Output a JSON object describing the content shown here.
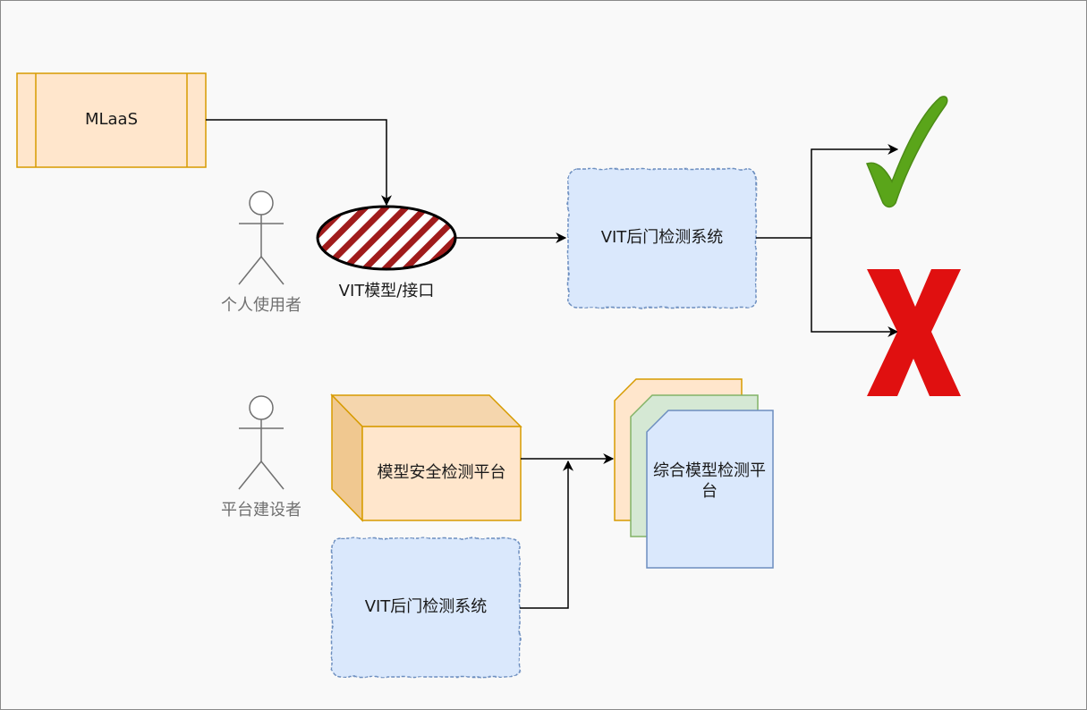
{
  "nodes": {
    "mlaas": "MLaaS",
    "individual_user": "个人使用者",
    "vit_model_api": "VIT模型/接口",
    "vit_backdoor_top": "VIT后门检测系统",
    "platform_builder": "平台建设者",
    "model_security_platform": "模型安全检测平台",
    "vit_backdoor_bottom": "VIT后门检测系统",
    "integrated_platform": "综合模型检测平台"
  },
  "results": {
    "pass_icon": "check-mark-icon",
    "fail_icon": "cross-mark-icon"
  },
  "colors": {
    "orange_fill": "#ffe6cc",
    "orange_stroke": "#d79b00",
    "blue_fill": "#dae8fc",
    "blue_stroke": "#6c8ebf",
    "green_fill": "#d5e8d4",
    "green_stroke": "#82b366",
    "hatch_red": "#a01c1c",
    "check_green": "#5aa51a",
    "cross_red": "#e01010",
    "actor_stroke": "#707070"
  }
}
